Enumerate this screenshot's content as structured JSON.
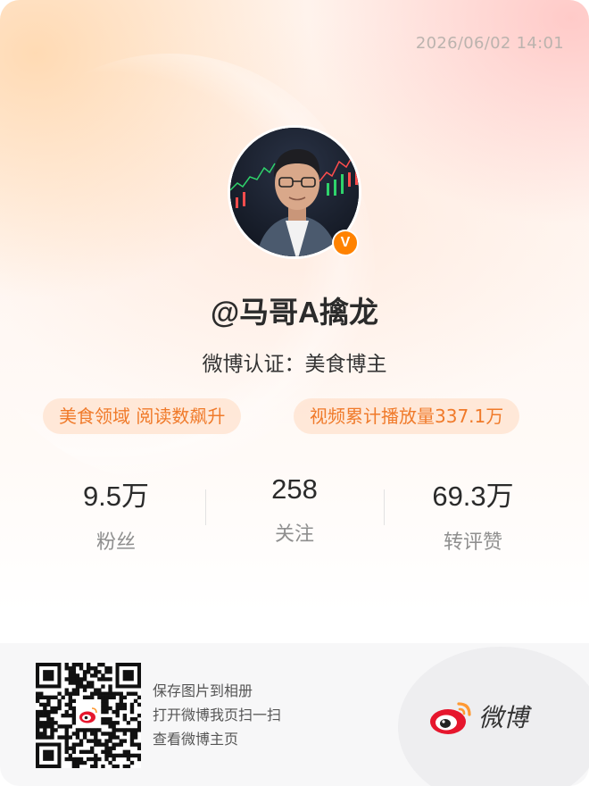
{
  "timestamp": "2026/06/02 14:01",
  "profile": {
    "username": "@马哥A擒龙",
    "verification": "微博认证：美食博主",
    "badge": "V"
  },
  "tags": [
    "美食领域 阅读数飙升",
    "视频累计播放量337.1万"
  ],
  "stats": [
    {
      "value": "9.5万",
      "label": "粉丝"
    },
    {
      "value": "258",
      "label": "关注"
    },
    {
      "value": "69.3万",
      "label": "转评赞"
    }
  ],
  "footer": {
    "hints": [
      "保存图片到相册",
      "打开微博我页扫一扫",
      "查看微博主页"
    ],
    "logo_text": "微博"
  },
  "colors": {
    "accent": "#ff8200",
    "tag_text": "#f07a2a",
    "tag_bg": "#ffe2ce"
  }
}
